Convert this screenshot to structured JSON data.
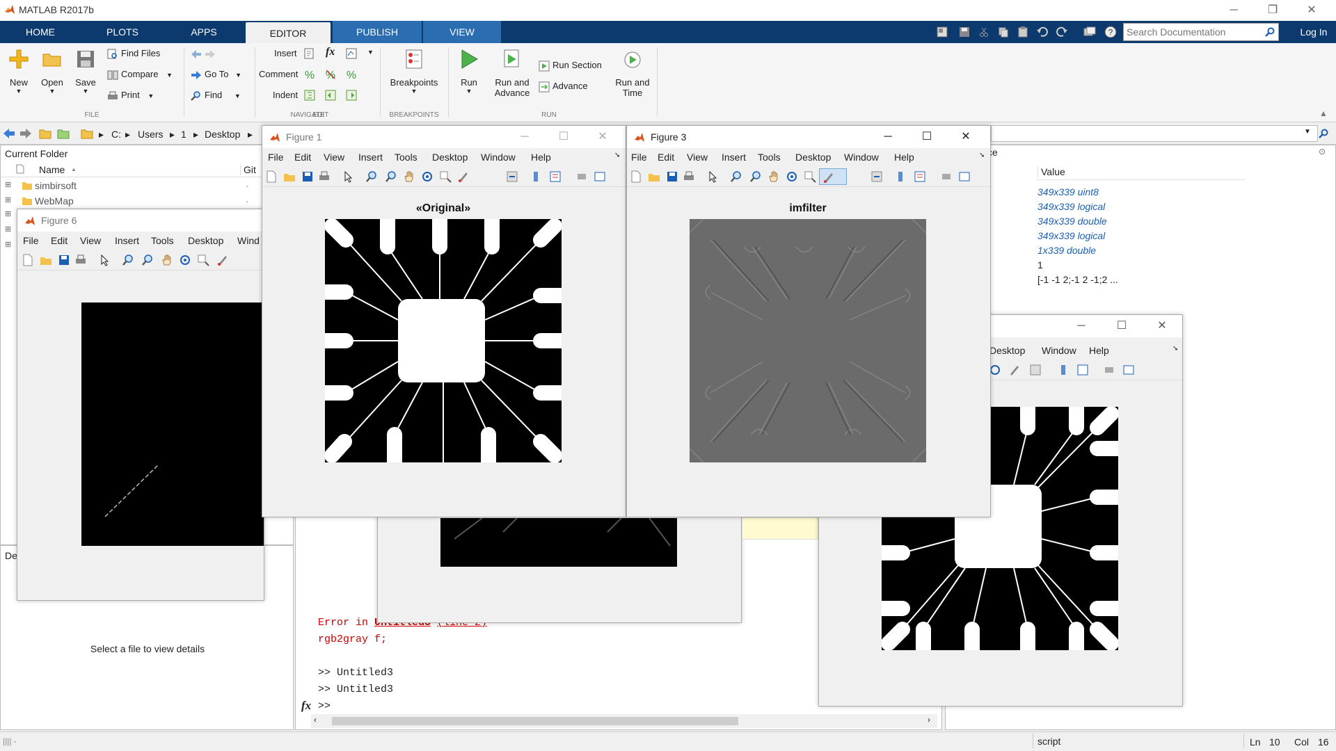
{
  "app": {
    "title": "MATLAB R2017b"
  },
  "tabs": [
    "HOME",
    "PLOTS",
    "APPS",
    "EDITOR",
    "PUBLISH",
    "VIEW"
  ],
  "search": {
    "placeholder": "Search Documentation"
  },
  "login": "Log In",
  "ribbon": {
    "file": {
      "new": "New",
      "open": "Open",
      "save": "Save",
      "find_files": "Find Files",
      "compare": "Compare",
      "print": "Print",
      "label": "FILE"
    },
    "navigate": {
      "go_to": "Go To",
      "find": "Find",
      "label": "NAVIGATE"
    },
    "edit": {
      "insert": "Insert",
      "comment": "Comment",
      "indent": "Indent",
      "label": "EDIT",
      "fx": "fx"
    },
    "breakpoints": {
      "button": "Breakpoints",
      "label": "BREAKPOINTS"
    },
    "run": {
      "run": "Run",
      "run_advance_1": "Run and",
      "run_advance_2": "Advance",
      "run_section": "Run Section",
      "advance": "Advance",
      "run_time_1": "Run and",
      "run_time_2": "Time",
      "label": "RUN"
    }
  },
  "address": {
    "path": [
      "C:",
      "Users",
      "1",
      "Desktop"
    ]
  },
  "current_folder": {
    "title": "Current Folder",
    "col_name": "Name",
    "col_sort": "▲",
    "col_git": "Git",
    "items": [
      "simbirsoft",
      "WebMap"
    ],
    "git_marks": [
      "·",
      "·"
    ],
    "details_label": "De",
    "details_text": "Select a file to view details"
  },
  "workspace": {
    "title_fragment": "ce",
    "col_value": "Value",
    "values": [
      "349x339 uint8",
      "349x339 logical",
      "349x339 double",
      "349x339 logical",
      "1x339 double",
      "1",
      "[-1 -1 2;-1 2 -1;2 ..."
    ]
  },
  "command": {
    "error_prefix": "Error in ",
    "error_file": "Untitled3",
    "error_line": "(line 2)",
    "error_code": "rgb2gray f;",
    "history": [
      ">> Untitled3",
      ">> Untitled3"
    ],
    "prompt": ">>",
    "fx": "fx"
  },
  "figures": {
    "fig1": {
      "title": "Figure 1",
      "axes_title": "«Original»"
    },
    "fig3": {
      "title": "Figure 3",
      "axes_title": "imfilter"
    },
    "fig6": {
      "title": "Figure 6"
    },
    "menu": [
      "File",
      "Edit",
      "View",
      "Insert",
      "Tools",
      "Desktop",
      "Window",
      "Help"
    ],
    "fig6_menu": [
      "File",
      "Edit",
      "View",
      "Insert",
      "Tools",
      "Desktop",
      "Wind"
    ],
    "fig_right_menu": [
      "Desktop",
      "Window",
      "Help"
    ],
    "dock_arrow": "➘"
  },
  "window_controls": {
    "minimize": "─",
    "maximize": "☐",
    "close": "✕",
    "restore": "❐"
  },
  "status": {
    "type": "script",
    "ln_label": "Ln",
    "ln": "10",
    "col_label": "Col",
    "col": "16",
    "grip": "|||| -"
  },
  "colors": {
    "ribbon_tabs": "#0d3a6e",
    "error": "#cc0000",
    "link": "#1a5fb4"
  }
}
